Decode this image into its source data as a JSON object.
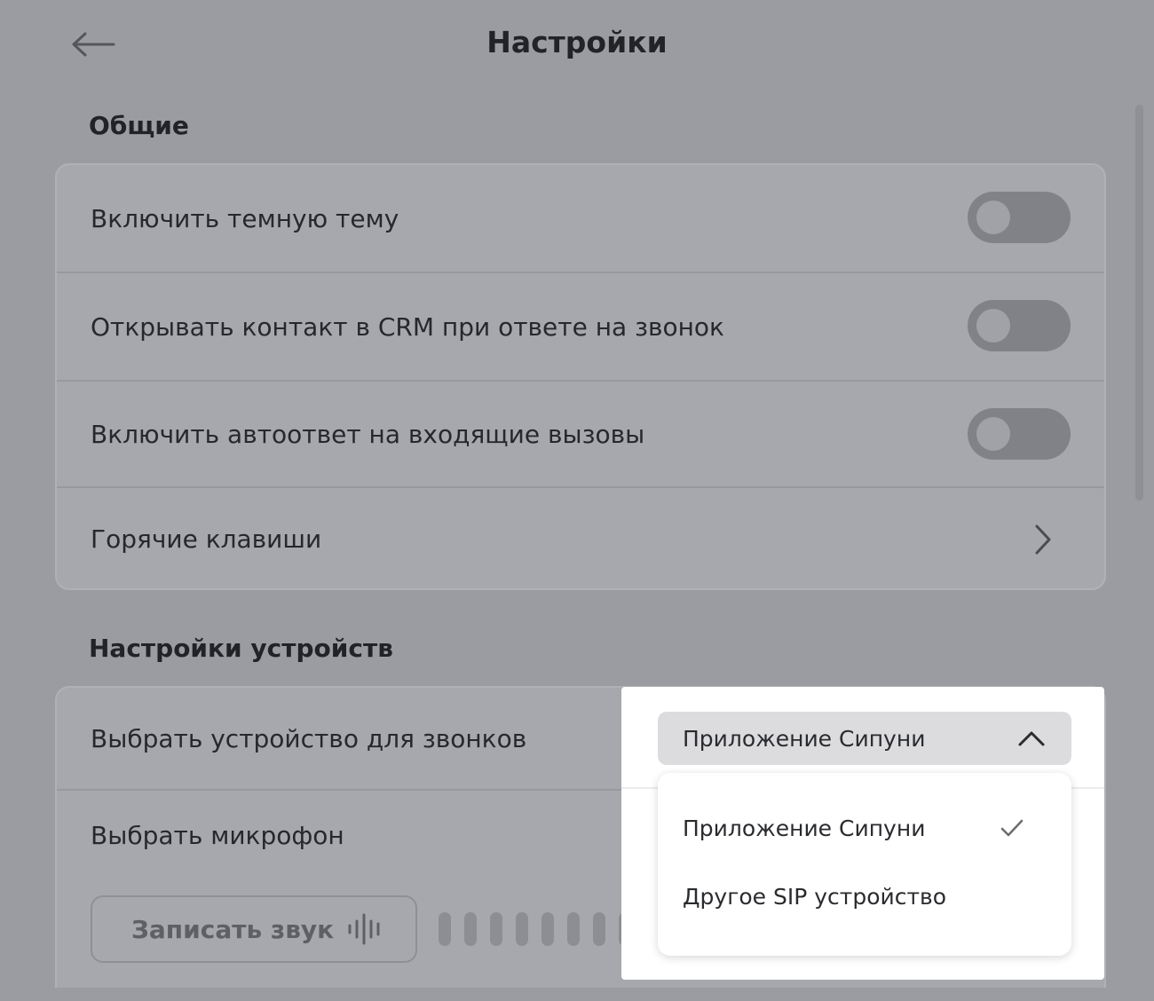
{
  "header": {
    "title": "Настройки",
    "back_icon": "arrow-left-icon"
  },
  "general": {
    "title": "Общие",
    "rows": [
      {
        "label": "Включить темную тему",
        "control": "toggle",
        "checked": false
      },
      {
        "label": "Открывать контакт в CRM при ответе на звонок",
        "control": "toggle",
        "checked": false
      },
      {
        "label": "Включить автоответ на входящие вызовы",
        "control": "toggle",
        "checked": false
      },
      {
        "label": "Горячие клавиши",
        "control": "chevron-right-icon"
      }
    ]
  },
  "devices": {
    "title": "Настройки устройств",
    "call_device": {
      "label": "Выбрать устройство для звонков",
      "selected": "Приложение Сипуни",
      "expanded": true,
      "options": [
        {
          "label": "Приложение Сипуни",
          "selected": true
        },
        {
          "label": "Другое SIP устройство",
          "selected": false
        }
      ]
    },
    "microphone": {
      "label": "Выбрать микрофон",
      "record_button_label": "Записать звук",
      "record_icon": "sound-wave-icon",
      "level_bars": 9
    }
  },
  "colors": {
    "overlay_background": "#9b9ca1",
    "card_background": "#a7a8ad",
    "toggle_off": "#818287",
    "highlight": "#ffffff"
  }
}
